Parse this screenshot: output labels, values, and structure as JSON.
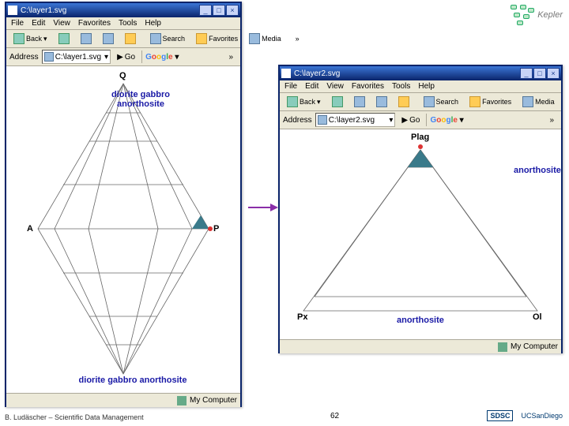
{
  "slide": {
    "number": "62",
    "credit": "B. Ludäscher – Scientific Data Management",
    "kepler_label": "Kepler",
    "sdsc": "SDSC",
    "ucsd": "UCSanDiego"
  },
  "win1": {
    "title": "C:\\layer1.svg",
    "menu": [
      "File",
      "Edit",
      "View",
      "Favorites",
      "Tools",
      "Help"
    ],
    "toolbar": {
      "back": "Back",
      "search": "Search",
      "favorites": "Favorites",
      "media": "Media"
    },
    "address_label": "Address",
    "address_value": "C:\\layer1.svg",
    "go": "Go",
    "google": "Google",
    "status": "My Computer",
    "diagram": {
      "Q": "Q",
      "A": "A",
      "P": "P",
      "title_line1": "diorite gabbro",
      "title_line2": "anorthosite",
      "bottom_title": "diorite gabbro anorthosite"
    }
  },
  "win2": {
    "title": "C:\\layer2.svg",
    "menu": [
      "File",
      "Edit",
      "View",
      "Favorites",
      "Tools",
      "Help"
    ],
    "toolbar": {
      "back": "Back",
      "search": "Search",
      "favorites": "Favorites",
      "media": "Media"
    },
    "address_label": "Address",
    "address_value": "C:\\layer2.svg",
    "go": "Go",
    "google": "Google",
    "status": "My Computer",
    "diagram": {
      "plag": "Plag",
      "anorth": "anorthosite",
      "px": "Px",
      "ol": "Ol",
      "bottom_anorth": "anorthosite"
    }
  }
}
